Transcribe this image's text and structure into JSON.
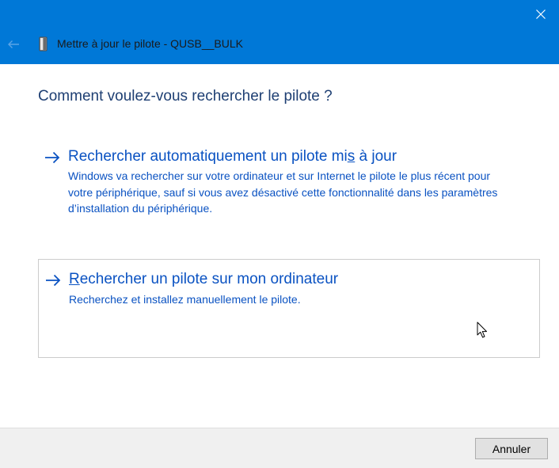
{
  "window": {
    "title": "Mettre à jour le pilote - QUSB__BULK",
    "accent_color": "#0078d7",
    "back_icon": "back-arrow-icon",
    "close_icon": "close-icon",
    "device_icon": "usb-device-icon"
  },
  "main": {
    "question": "Comment voulez-vous rechercher le pilote ?",
    "options": [
      {
        "title_before": "Rechercher automatiquement un pilote mi",
        "title_accel": "s",
        "title_after": " à jour",
        "desc_lines": [
          "Windows va rechercher sur votre ordinateur et sur Internet le pilote le plus récent pour",
          "votre périphérique, sauf si vous avez désactivé cette fonctionnalité dans les paramètres",
          "d’installation du périphérique."
        ]
      },
      {
        "title_accel": "R",
        "title_after": "echercher un pilote sur mon ordinateur",
        "desc_lines": [
          "Recherchez et installez manuellement le pilote."
        ]
      }
    ]
  },
  "footer": {
    "cancel_label": "Annuler"
  }
}
